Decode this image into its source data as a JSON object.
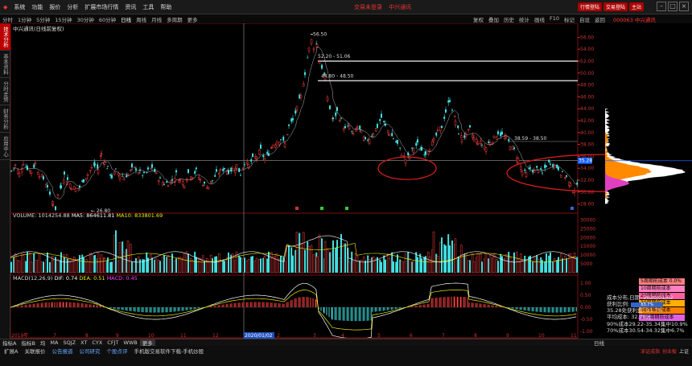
{
  "menubar": {
    "items": [
      "系统",
      "功能",
      "报价",
      "分析",
      "扩展市场行情",
      "资讯",
      "工具",
      "帮助"
    ],
    "center": [
      "交易未登录",
      "中兴通讯"
    ],
    "red_buttons": [
      "行情登陆",
      "交易登陆",
      "主站"
    ]
  },
  "toolbar": {
    "periods": [
      "分时",
      "1分钟",
      "5分钟",
      "15分钟",
      "30分钟",
      "60分钟",
      "日线",
      "周线",
      "月线",
      "多周期",
      "更多"
    ],
    "active": "日线",
    "right_items": [
      "复权",
      "叠加",
      "历史",
      "统计",
      "画线",
      "F10",
      "标记",
      "自设",
      "返回"
    ],
    "right_title": "000063 中兴通讯"
  },
  "sidebar": {
    "tabs": [
      "技术分析",
      "基本资料",
      "分时走势",
      "财务分析",
      "应用中心"
    ]
  },
  "chart_header": {
    "main": "中兴通讯(日线前复权)",
    "volume_label": "VOLUME: 1014254.88",
    "ma5_label": "MA5: 864611.81",
    "ma10_label": "MA10: 833801.69",
    "macd_label": "MACD(12,26,9)",
    "dif_label": "DIF: 0.74",
    "dea_label": "DEA: 0.51",
    "macd_val_label": "MACD: 0.45"
  },
  "annotations": {
    "high": "56.50",
    "low": "26.80",
    "resist1": "52.20 - 51.06",
    "resist2": "48.80 - 48.50",
    "resist3": "38.59 - 38.50",
    "current": "35.28"
  },
  "x_axis": [
    "2019年",
    "7",
    "8",
    "9",
    "10",
    "11",
    "12",
    "2020/01/02",
    "2",
    "3",
    "4",
    "5",
    "6",
    "7",
    "8",
    "9",
    "10",
    "11"
  ],
  "date_label": "2020/01/02",
  "y_axis_main": [
    "56.00",
    "54.00",
    "52.00",
    "50.00",
    "48.00",
    "46.00",
    "44.00",
    "42.00",
    "40.00",
    "38.00",
    "36.00",
    "34.00",
    "32.00",
    "30.00",
    "28.00"
  ],
  "y_axis_vol": [
    "30000",
    "25000",
    "20000",
    "15000",
    "10000",
    "5000"
  ],
  "y_axis_macd": [
    "1.00",
    "0.50",
    "0.00",
    "-0.50",
    "-1.00"
  ],
  "chip_legend": [
    {
      "label": "5周期前成本 0.0%",
      "color": "#ff8080"
    },
    {
      "label": "10周期前成本 78.1%",
      "color": "#ff80c0"
    },
    {
      "label": "20周期前成本 81.2%",
      "color": "#ff60a0"
    },
    {
      "label": "30周期前成本 53.4%",
      "color": "#ffb000"
    },
    {
      "label": "60周期前成本 29.5%",
      "color": "#ff8000"
    },
    {
      "label": "100周期前成本 9.3%",
      "color": "#e060e0"
    }
  ],
  "chip_info": {
    "title": "成本分布,日期: 2020/01/02",
    "profit_label": "获利比例:",
    "profit_value": "83.7%",
    "profit_line": "35.28处获利盘: 93.7%",
    "avg_cost": "平均成本: 32.78元",
    "cost90": "90%成本29.22-35.34集中10.9%",
    "cost70": "70%成本30.54-34.32集中6.7%"
  },
  "bottom_tabs": [
    "指标A",
    "指标B",
    "均",
    "MA",
    "SQJZ",
    "XT",
    "CYX",
    "CFJT",
    "WWB",
    "更多"
  ],
  "bottom_right": "日线",
  "bottom_row2": [
    "扩展A",
    "关联报价",
    "公告报道",
    "公司研究",
    "个股点评",
    "手机版交易软件下载-手机炒股"
  ],
  "status_items": [
    "深证成指",
    "创业板",
    "上证"
  ],
  "chart_data": {
    "type": "candlestick",
    "title": "中兴通讯(日线前复权)",
    "ylim": [
      27,
      57
    ],
    "x_start": "2019-06",
    "x_end": "2020-11",
    "price_points": [
      [
        0,
        33.5
      ],
      [
        5,
        34.5
      ],
      [
        10,
        33.0
      ],
      [
        15,
        35.0
      ],
      [
        20,
        34.0
      ],
      [
        25,
        33.5
      ],
      [
        30,
        34.8
      ],
      [
        35,
        33.0
      ],
      [
        40,
        32.2
      ],
      [
        45,
        31.0
      ],
      [
        48,
        29.2
      ],
      [
        52,
        28.2
      ],
      [
        55,
        27.2
      ],
      [
        58,
        29.5
      ],
      [
        62,
        31.0
      ],
      [
        66,
        32.8
      ],
      [
        70,
        32.0
      ],
      [
        75,
        31.0
      ],
      [
        80,
        30.5
      ],
      [
        85,
        30.8
      ],
      [
        90,
        32.0
      ],
      [
        95,
        33.0
      ],
      [
        100,
        34.0
      ],
      [
        104,
        34.5
      ],
      [
        108,
        33.8
      ],
      [
        112,
        36.5
      ],
      [
        116,
        35.0
      ],
      [
        120,
        34.0
      ],
      [
        125,
        32.5
      ],
      [
        130,
        33.5
      ],
      [
        135,
        33.0
      ],
      [
        140,
        32.5
      ],
      [
        145,
        33.0
      ],
      [
        150,
        33.8
      ],
      [
        155,
        34.0
      ],
      [
        160,
        33.2
      ],
      [
        165,
        32.8
      ],
      [
        170,
        33.5
      ],
      [
        175,
        34.2
      ],
      [
        180,
        33.0
      ],
      [
        185,
        32.0
      ],
      [
        190,
        31.5
      ],
      [
        195,
        31.5
      ],
      [
        200,
        32.0
      ],
      [
        205,
        33.0
      ],
      [
        210,
        32.0
      ],
      [
        215,
        31.5
      ],
      [
        220,
        33.2
      ],
      [
        225,
        32.8
      ],
      [
        230,
        33.5
      ],
      [
        235,
        32.0
      ],
      [
        240,
        31.2
      ],
      [
        245,
        31.0
      ],
      [
        250,
        32.0
      ],
      [
        255,
        33.0
      ],
      [
        260,
        33.5
      ],
      [
        265,
        34.0
      ],
      [
        270,
        33.5
      ],
      [
        275,
        33.8
      ],
      [
        280,
        34.5
      ],
      [
        285,
        33.0
      ],
      [
        290,
        35.0
      ],
      [
        295,
        34.5
      ],
      [
        300,
        35.5
      ],
      [
        305,
        36.0
      ],
      [
        310,
        37.0
      ],
      [
        315,
        35.5
      ],
      [
        320,
        36.5
      ],
      [
        325,
        38.0
      ],
      [
        330,
        38.5
      ],
      [
        335,
        39.0
      ],
      [
        340,
        38.0
      ],
      [
        345,
        41.0
      ],
      [
        350,
        42.0
      ],
      [
        355,
        44.0
      ],
      [
        360,
        46.0
      ],
      [
        365,
        50.0
      ],
      [
        370,
        54.0
      ],
      [
        373,
        55.5
      ],
      [
        376,
        54.5
      ],
      [
        380,
        55.0
      ],
      [
        383,
        52.0
      ],
      [
        386,
        51.0
      ],
      [
        390,
        49.0
      ],
      [
        393,
        46.0
      ],
      [
        396,
        44.0
      ],
      [
        400,
        42.0
      ],
      [
        405,
        43.5
      ],
      [
        410,
        42.0
      ],
      [
        415,
        40.5
      ],
      [
        420,
        41.0
      ],
      [
        425,
        39.5
      ],
      [
        430,
        41.0
      ],
      [
        435,
        40.0
      ],
      [
        440,
        38.5
      ],
      [
        445,
        39.0
      ],
      [
        450,
        40.0
      ],
      [
        455,
        41.0
      ],
      [
        460,
        42.5
      ],
      [
        465,
        41.0
      ],
      [
        470,
        40.0
      ],
      [
        475,
        39.0
      ],
      [
        480,
        38.0
      ],
      [
        485,
        36.5
      ],
      [
        490,
        35.5
      ],
      [
        495,
        36.0
      ],
      [
        500,
        37.5
      ],
      [
        505,
        38.0
      ],
      [
        510,
        37.0
      ],
      [
        515,
        36.5
      ],
      [
        520,
        37.5
      ],
      [
        525,
        38.5
      ],
      [
        530,
        40.0
      ],
      [
        535,
        41.0
      ],
      [
        540,
        43.5
      ],
      [
        545,
        45.5
      ],
      [
        548,
        44.0
      ],
      [
        552,
        42.0
      ],
      [
        556,
        40.0
      ],
      [
        560,
        39.0
      ],
      [
        565,
        39.5
      ],
      [
        570,
        40.5
      ],
      [
        575,
        39.0
      ],
      [
        580,
        38.5
      ],
      [
        585,
        38.0
      ],
      [
        590,
        37.5
      ],
      [
        595,
        38.5
      ],
      [
        600,
        39.0
      ],
      [
        605,
        40.0
      ],
      [
        610,
        39.5
      ],
      [
        615,
        39.0
      ],
      [
        620,
        38.0
      ],
      [
        625,
        37.0
      ],
      [
        630,
        35.5
      ],
      [
        635,
        33.5
      ],
      [
        640,
        33.0
      ],
      [
        645,
        34.0
      ],
      [
        650,
        33.5
      ],
      [
        655,
        34.0
      ],
      [
        660,
        33.0
      ],
      [
        665,
        34.5
      ],
      [
        670,
        35.0
      ],
      [
        675,
        34.5
      ],
      [
        680,
        34.0
      ],
      [
        685,
        33.0
      ],
      [
        690,
        32.5
      ],
      [
        695,
        31.0
      ],
      [
        700,
        30.5
      ],
      [
        705,
        31.0
      ]
    ]
  }
}
